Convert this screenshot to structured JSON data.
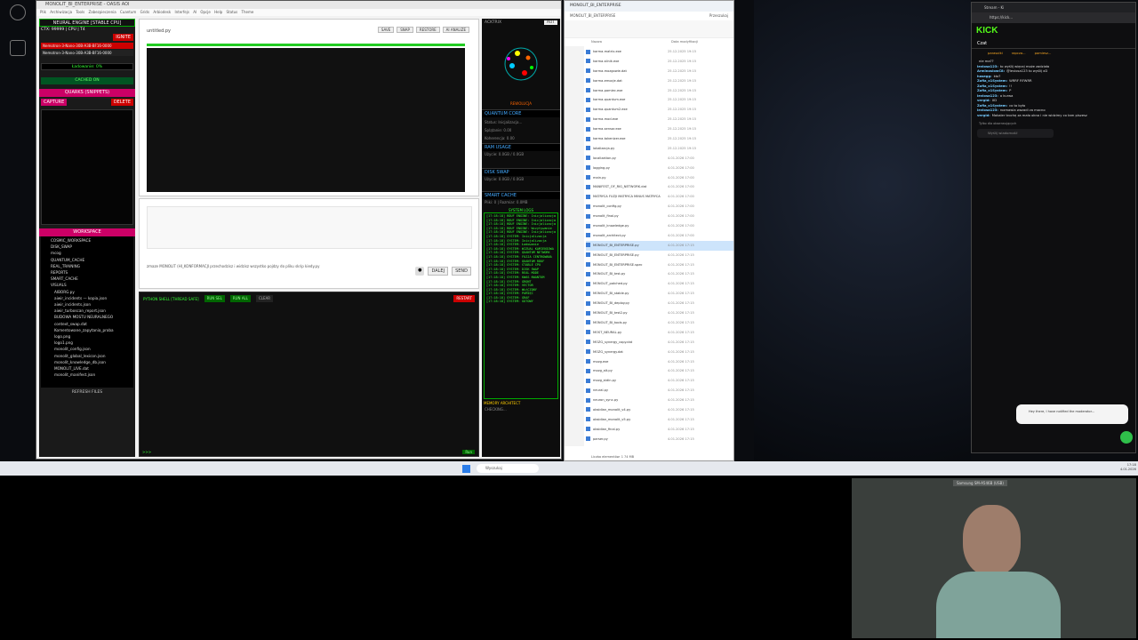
{
  "app": {
    "title": "MONOLIT_BI_ENTERPRISE - OASIS AOI",
    "menu": "Plik Archiwizacja Tools Zabezpieczenia Cuantum Grids Arbiodesk Interfejs AI Opcje Help Status Theme",
    "left": {
      "engine_title": "NEURAL ENGINE [STABLE CPU]",
      "ctx": "CTX: 99999 | CPU | T4",
      "ignite": "IGNITE",
      "models": [
        "Nemotron-3-Nano-30B-A3B-BF16-0000",
        "Nemotron-3-Nano-30B-A3B-BF16-0000"
      ],
      "loading": "Ładowanie: 0%",
      "cache": "CACHED ON",
      "quarks_title": "QUARKS (SNIPPETS)",
      "capture": "CAPTURE",
      "delete": "DELETE",
      "workspace_title": "WORKSPACE",
      "tree": [
        "COSMIC_WORKSPACE",
        "DISK_SWAP",
        "mcog",
        "QUANTUM_CACHE",
        "REAL_TRAINING",
        "REPORTS",
        "SMART_CACHE",
        "VISUALS",
        "AIBORG.py",
        "aiwir_incidents — kopia.json",
        "aiwir_incidents.json",
        "aiwir_turboscan_report.json",
        "BUDOWA MOSTU NEURALNEGO",
        "context_swap.dat",
        "Komentowane_zapytania_proba",
        "logo.png",
        "logo1.png",
        "monolit_config.json",
        "monolit_global_lexicon.json",
        "monolit_knowledge_db.json",
        "MONOLIT_LIVE.dat",
        "monolit_manifest.json"
      ],
      "refresh": "REFRESH FILES"
    },
    "editor": {
      "tab": "untitled.py",
      "buttons": [
        "SAVE",
        "SNAP",
        "RESTORE",
        "AI ANALIZE"
      ]
    },
    "prompt": {
      "text": "zmaze MONOLIT (HI_KONFORMACJI przechodzisz i widzisz wszystko pojdzy do pliku skrip kiedy.py",
      "next": "DALEJ",
      "send": "SEND"
    },
    "shell": {
      "title": "PYTHON SHELL [THREAD SAFE]",
      "run_sel": "RUN SEL",
      "run_all": "RUN ALL",
      "clear": "CLEAR",
      "restart": "RESTART",
      "prompt": ">>>",
      "run": "Run"
    },
    "right": {
      "active": "ACKTRIX",
      "auto": "AUT",
      "reaction": "REWOLUCJA",
      "quantum_title": "QUANTUM CORE",
      "quantum_lines": [
        "Status: Inicjalizacja...",
        "Splątanie: 0.00",
        "Koherencja: 0.00"
      ],
      "ram_title": "RAM USAGE",
      "ram_line": "Użycie: 0.0GB / 0.0GB",
      "disk_title": "DISK SWAP",
      "disk_line": "Użycie: 0.0GB / 0.0GB",
      "smart_title": "SMART CACHE",
      "smart_line": "Pliki: 0 | Rozmiar: 0.0MB",
      "log_title": "SYSTEM LOGS",
      "logs": [
        "[17:18:18] RDUF ENGINE: Inicjalizacja",
        "[17:18:18] RDUF ENGINE: Inicjalizacja",
        "[17:18:18] RDUF ENGINE: Inicjalizacja",
        "[17:18:18] RDUF ENGINE: Wczytywanie",
        "[17:18:18] RDUF ENGINE: Inicjalizacja",
        "[17:18:18] SYSTEM: Inicjalizacja",
        "[17:18:18] SYSTEM: Inicjalizacja",
        "[17:18:18] SYSTEM: Ładowanie",
        "[17:18:18] SYSTEM: WIZUAL KAMIENIOWA",
        "[17:18:18] SYSTEM: QUANTUM NETWORK",
        "[17:18:18] SYSTEM: FUZJA CENTROWANA",
        "[17:18:18] SYSTEM: QUANTUM RDUF",
        "[17:18:18] SYSTEM: STABLE CPU",
        "[17:18:18] SYSTEM: DISK SWAP",
        "[17:18:18] SYSTEM: REAL MODE",
        "[17:18:18] SYSTEM: KWAS KWANTUM",
        "[17:18:18] SYSTEM: GRONT",
        "[17:18:18] SYSTEM: VECTOR",
        "[17:18:18] SYSTEM: WŁĄCZONY",
        "[17:18:18] SYSTEM: PAMIĘĆ",
        "[17:18:18] SYSTEM: GRAF",
        "[17:18:18] SYSTEM: GOTOWY"
      ],
      "memory_title": "MEMORY ARCHITECT",
      "memory_line": "CHECKING..."
    }
  },
  "explorer": {
    "path": "MONOLIT_BI_ENTERPRISE",
    "search": "Przeszukaj",
    "col_name": "Nazwa",
    "col_date": "Data modyfikacji",
    "files": [
      "karma-matrix.exe",
      "karma-silnik.exe",
      "karma-mozgowie.dat",
      "karma-emocje.dat",
      "karma-pamiec.exe",
      "karma-quantum.exe",
      "karma-quantum2.exe",
      "karma-mod.exe",
      "karma-sensor.exe",
      "karma-tokenizer.exe",
      "lokalizacja.py",
      "localization.py",
      "logging.py",
      "main.py",
      "MANIFEST_OF_RIG_NETWORK.dat",
      "MATRYCA FUZJI MATRYCA MINUS MATRYCA",
      "monolit_config.py",
      "monolit_final.py",
      "monolit_knowledge.py",
      "monolit_architect.py",
      "MONOLIT_BI_ENTERPRISE.py",
      "MONOLIT_BI_ENTERPRISE.py",
      "MONOLIT_BI_ENTERPRISE.spec",
      "MONOLIT_BI_test.py",
      "MONOLIT_patched.py",
      "MONOLIT_BI_stable.py",
      "MONOLIT_BI_deploy.py",
      "MONOLIT_BI_test2.py",
      "MONOLIT_BI_tools.py",
      "MOST_NEURAL.py",
      "MOZG_synergy_copy.dat",
      "MOZG_synergy.dat",
      "mozg.exe",
      "mozg_alt.py",
      "mozg_stdin.py",
      "neural.py",
      "neuron_sync.py",
      "obsidian_monolit_v4.py",
      "obsidian_monolit_v5.py",
      "obsidian_final.py",
      "parser.py",
      "portal_login.py",
      "portal_task.py",
      "quantum.exe",
      "quantum_final.exe",
      "qudit.py"
    ],
    "dates": [
      "25.12.2025 19:15",
      "25.12.2025 19:15",
      "25.12.2025 19:15",
      "25.12.2025 19:15",
      "25.12.2025 19:15",
      "25.12.2025 19:15",
      "25.12.2025 19:15",
      "25.12.2025 19:15",
      "25.12.2025 19:15",
      "25.12.2025 19:15",
      "25.12.2025 19:15",
      "4.01.2026 17:00",
      "4.01.2026 17:00",
      "4.01.2026 17:00",
      "4.01.2026 17:00",
      "4.01.2026 17:00",
      "4.01.2026 17:00",
      "4.01.2026 17:00",
      "4.01.2026 17:00",
      "4.01.2026 17:00",
      "4.01.2026 17:15",
      "4.01.2026 17:15",
      "4.01.2026 17:15",
      "4.01.2026 17:15",
      "4.01.2026 17:15",
      "4.01.2026 17:15",
      "4.01.2026 17:15",
      "4.01.2026 17:15",
      "4.01.2026 17:15",
      "4.01.2026 17:15",
      "4.01.2026 17:15",
      "4.01.2026 17:15",
      "4.01.2026 17:15",
      "4.01.2026 17:15",
      "4.01.2026 17:15",
      "4.01.2026 17:15",
      "4.01.2026 17:15",
      "4.01.2026 17:15",
      "4.01.2026 17:15",
      "4.01.2026 17:15",
      "4.01.2026 17:15",
      "4.01.2026 17:15",
      "4.01.2026 17:15",
      "4.01.2026 17:15",
      "4.01.2026 17:15",
      "4.01.2026 17:15"
    ],
    "status": "Liczba elementów: 1 74 MB"
  },
  "browser": {
    "tab1": "Stream - Ki",
    "url": "https://kick...",
    "logo": "KICK",
    "chat_title": "Czat",
    "pinned": [
      "parasolki",
      "rapcza...",
      "pomiesz..."
    ],
    "lines": [
      [
        "",
        "nie ma??"
      ],
      [
        "leviosa123:",
        "to wyślij więcej może zadziała"
      ],
      [
        "ArminoslowC8:",
        "@leviosa123 to wyślij xD"
      ],
      [
        "hasegg:",
        "kto?"
      ],
      [
        "Zofia_x1System:",
        "WRRF RFWRR"
      ],
      [
        "Zofia_x1System:",
        "!!"
      ],
      [
        "Zofia_x1System:",
        "P"
      ],
      [
        "leviosa123:",
        "o kurwa"
      ],
      [
        "vergid:",
        "XD"
      ],
      [
        "Zofia_x1System:",
        "co to było"
      ],
      [
        "leviosa123:",
        "rozmawia wazadi za mocno"
      ],
      [
        "vergid:",
        "Makaler trochę za mało okno i nie widzimy co tam piszesz"
      ]
    ],
    "only_followers": "Tylko dla obserwujących",
    "input": "Wyślij wiadomość",
    "popup": "Hey there, I have notified the moderator..."
  },
  "taskbar": {
    "search": "Wyszukaj",
    "time": "17:18",
    "date": "4.01.2026"
  },
  "camera": {
    "label": "Samsung SM-A546B (USB)"
  }
}
